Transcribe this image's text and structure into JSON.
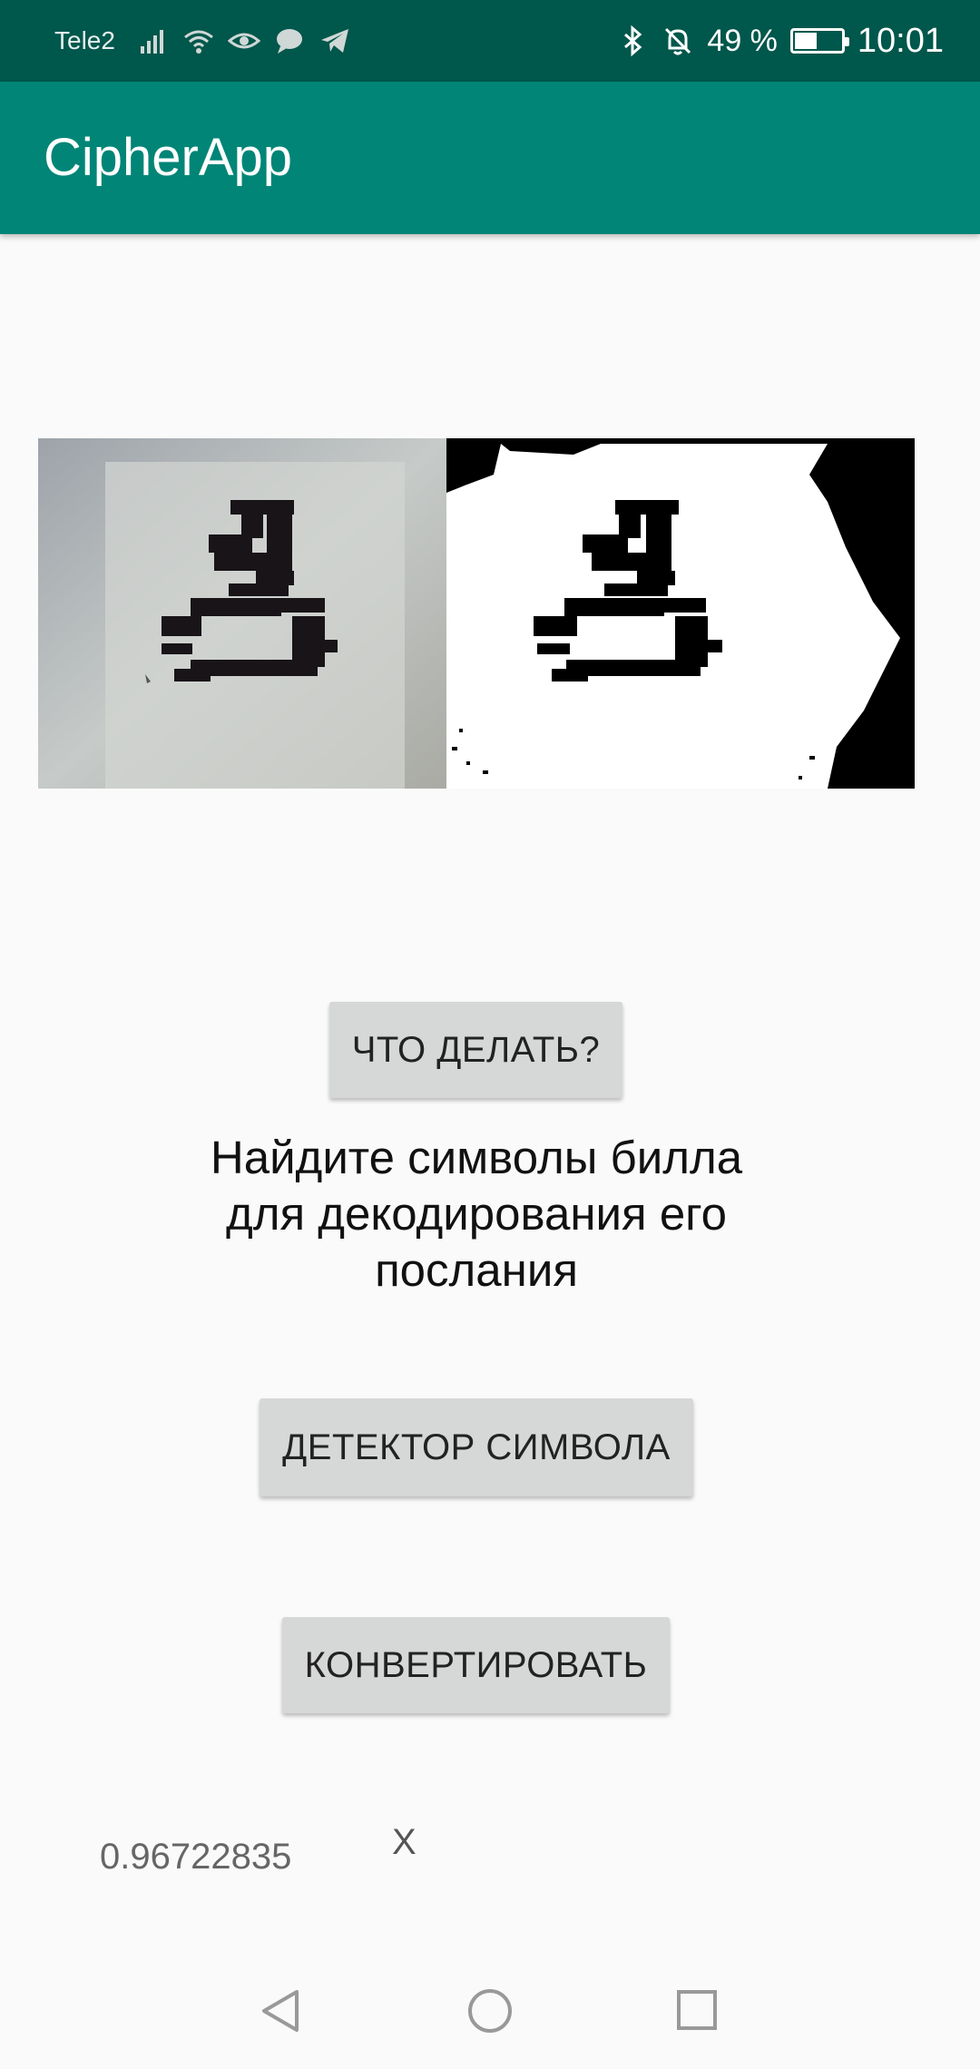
{
  "status_bar": {
    "carrier": "Tele2",
    "battery_percent": "49 %",
    "battery_level": 0.49,
    "time": "10:01",
    "icons": [
      "signal-icon",
      "wifi-icon",
      "eye-icon",
      "chat-icon",
      "telegram-icon",
      "bluetooth-icon",
      "mute-bell-icon",
      "battery-icon"
    ]
  },
  "app_bar": {
    "title": "CipherApp"
  },
  "images": {
    "original": "camera-preview-symbol",
    "processed": "binarized-symbol"
  },
  "buttons": {
    "what_to_do": "ЧТО ДЕЛАТЬ?",
    "detect": "ДЕТЕКТОР СИМВОЛА",
    "convert": "КОНВЕРТИРОВАТЬ"
  },
  "instruction": "Найдите символы билла для декодирования его послания",
  "result": {
    "score": "0.96722835",
    "letter": "X"
  },
  "nav_bar": {
    "icons": [
      "back-icon",
      "home-icon",
      "recents-icon"
    ]
  },
  "colors": {
    "status_bar": "#00574b",
    "app_bar": "#008577",
    "button": "#d6d7d7",
    "background": "#fafafa"
  }
}
